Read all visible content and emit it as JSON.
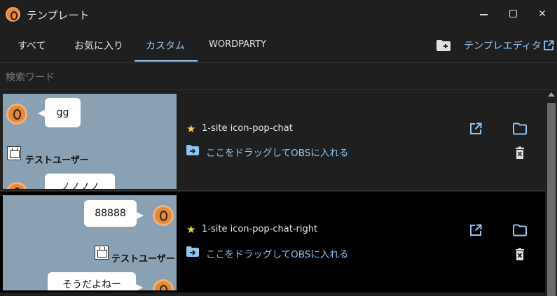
{
  "window": {
    "title": "テンプレート",
    "min_label": "",
    "close_label": "✕"
  },
  "tabs": [
    {
      "label": "すべて",
      "active": false
    },
    {
      "label": "お気に入り",
      "active": false
    },
    {
      "label": "カスタム",
      "active": true
    },
    {
      "label": "WORDPARTY",
      "active": false
    }
  ],
  "toolbar": {
    "editor_link": "テンプレエディタ",
    "new_folder_icon": "folder-add-icon",
    "external_icon": "open-external-icon"
  },
  "search": {
    "placeholder": "検索ワード",
    "value": ""
  },
  "templates": [
    {
      "name": "1-site icon-pop-chat",
      "favorite": true,
      "drag_label": "ここをドラッグしてOBSに入れる",
      "preview": {
        "bubble_1": "gg",
        "username": "テストユーザー",
        "bubble_2": "ノノノノ"
      }
    },
    {
      "name": "1-site icon-pop-chat-right",
      "favorite": true,
      "drag_label": "ここをドラッグしてOBSに入れる",
      "preview": {
        "bubble_1": "88888",
        "username": "テストユーザー",
        "bubble_2": "そうだよねー"
      }
    }
  ],
  "colors": {
    "accent": "#8ec5f5",
    "background": "#1f1f1f",
    "preview_bg": "#8aa1b3",
    "star": "#f7d23a",
    "avatar": "#e08a3e"
  }
}
